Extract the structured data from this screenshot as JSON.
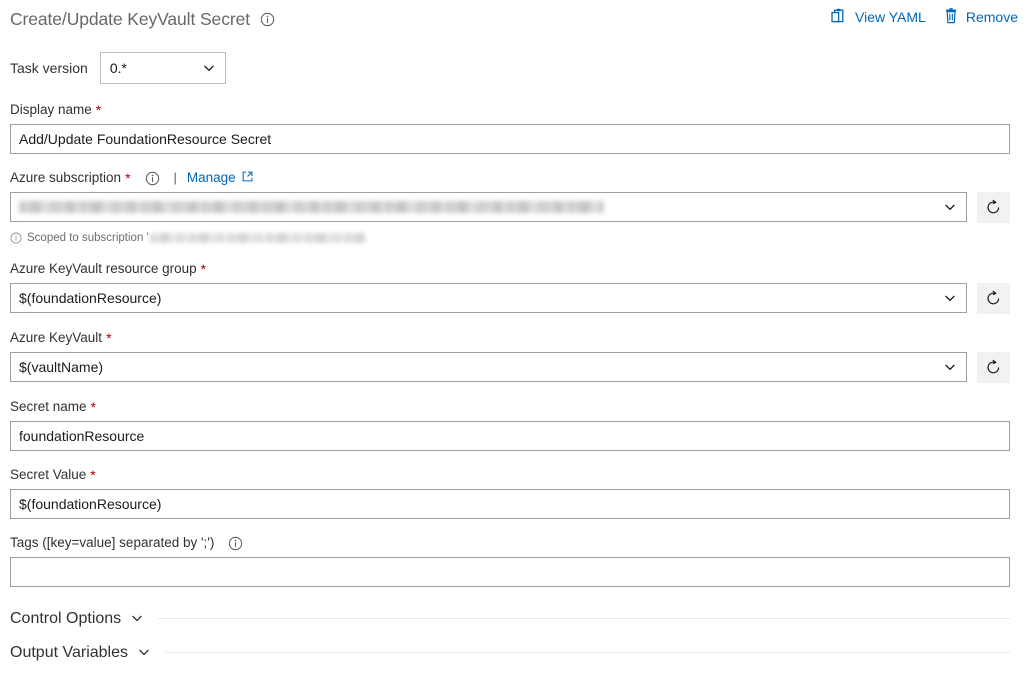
{
  "header": {
    "title": "Create/Update KeyVault Secret",
    "info_icon": "info-circle-icon",
    "actions": [
      {
        "label": "View YAML",
        "icon": "clipboard-icon"
      },
      {
        "label": "Remove",
        "icon": "trash-icon"
      }
    ]
  },
  "task_version": {
    "label": "Task version",
    "value": "0.*",
    "chevron_icon": "chevron-down-icon"
  },
  "fields": {
    "display_name": {
      "label": "Display name",
      "required": true,
      "value": "Add/Update FoundationResource Secret",
      "placeholder": ""
    },
    "azure_subscription": {
      "label": "Azure subscription",
      "required": true,
      "info_icon": "info-circle-icon",
      "separator": "|",
      "manage_label": "Manage",
      "manage_icon": "external-link-icon",
      "value": "",
      "value_redacted": true,
      "refresh_icon": "refresh-icon",
      "hint_icon": "info-circle-icon",
      "hint_text": "Scoped to subscription '",
      "hint_redacted": true
    },
    "resource_group": {
      "label": "Azure KeyVault resource group",
      "required": true,
      "value": "$(foundationResource)",
      "refresh_icon": "refresh-icon"
    },
    "key_vault": {
      "label": "Azure KeyVault",
      "required": true,
      "value": "$(vaultName)",
      "refresh_icon": "refresh-icon"
    },
    "secret_name": {
      "label": "Secret name",
      "required": true,
      "value": "foundationResource",
      "placeholder": ""
    },
    "secret_value": {
      "label": "Secret Value",
      "required": true,
      "value": "$(foundationResource)",
      "placeholder": ""
    },
    "tags": {
      "label": "Tags ([key=value] separated by ';')",
      "required": false,
      "info_icon": "info-circle-icon",
      "value": "",
      "placeholder": ""
    }
  },
  "sections": [
    {
      "title": "Control Options",
      "chevron_icon": "chevron-down-icon"
    },
    {
      "title": "Output Variables",
      "chevron_icon": "chevron-down-icon"
    }
  ],
  "colors": {
    "link": "#0067b8",
    "required_asterisk": "#a80000",
    "title_text": "#68686b",
    "body_text": "#323130",
    "input_border": "#a19f9d",
    "button_bg": "#f3f2f1"
  }
}
